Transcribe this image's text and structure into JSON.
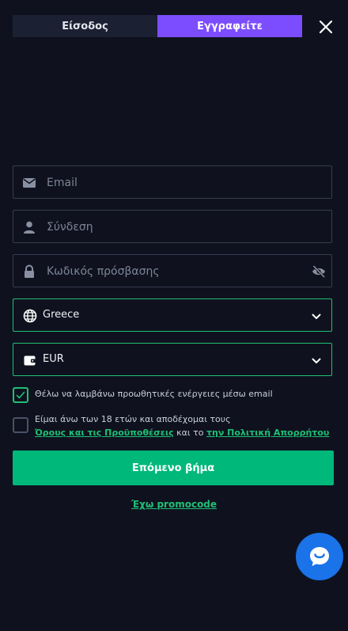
{
  "tabs": {
    "login": "Είσοδος",
    "register": "Εγγραφείτε"
  },
  "form": {
    "email_placeholder": "Email",
    "username_placeholder": "Σύνδεση",
    "password_placeholder": "Κωδικός πρόσβασης",
    "country_value": "Greece",
    "currency_value": "EUR"
  },
  "checkboxes": {
    "promo_email_label": "Θέλω να λαμβάνω προωθητικές ενέργειες μέσω email",
    "promo_email_checked": true,
    "terms_prefix": "Είμαι άνω των 18 ετών και αποδέχομαι τους",
    "terms_link": "Όρους και τις Προϋποθέσεις",
    "terms_and": "και το",
    "privacy_link": "την Πολιτική Απορρήτου",
    "terms_checked": false
  },
  "next_button": "Επόμενο βήμα",
  "promo_link": "Έχω promocode",
  "colors": {
    "accent_purple": "#7c4dff",
    "accent_green": "#00b87a",
    "background": "#0f121e",
    "chat_blue": "#1a73e8"
  }
}
